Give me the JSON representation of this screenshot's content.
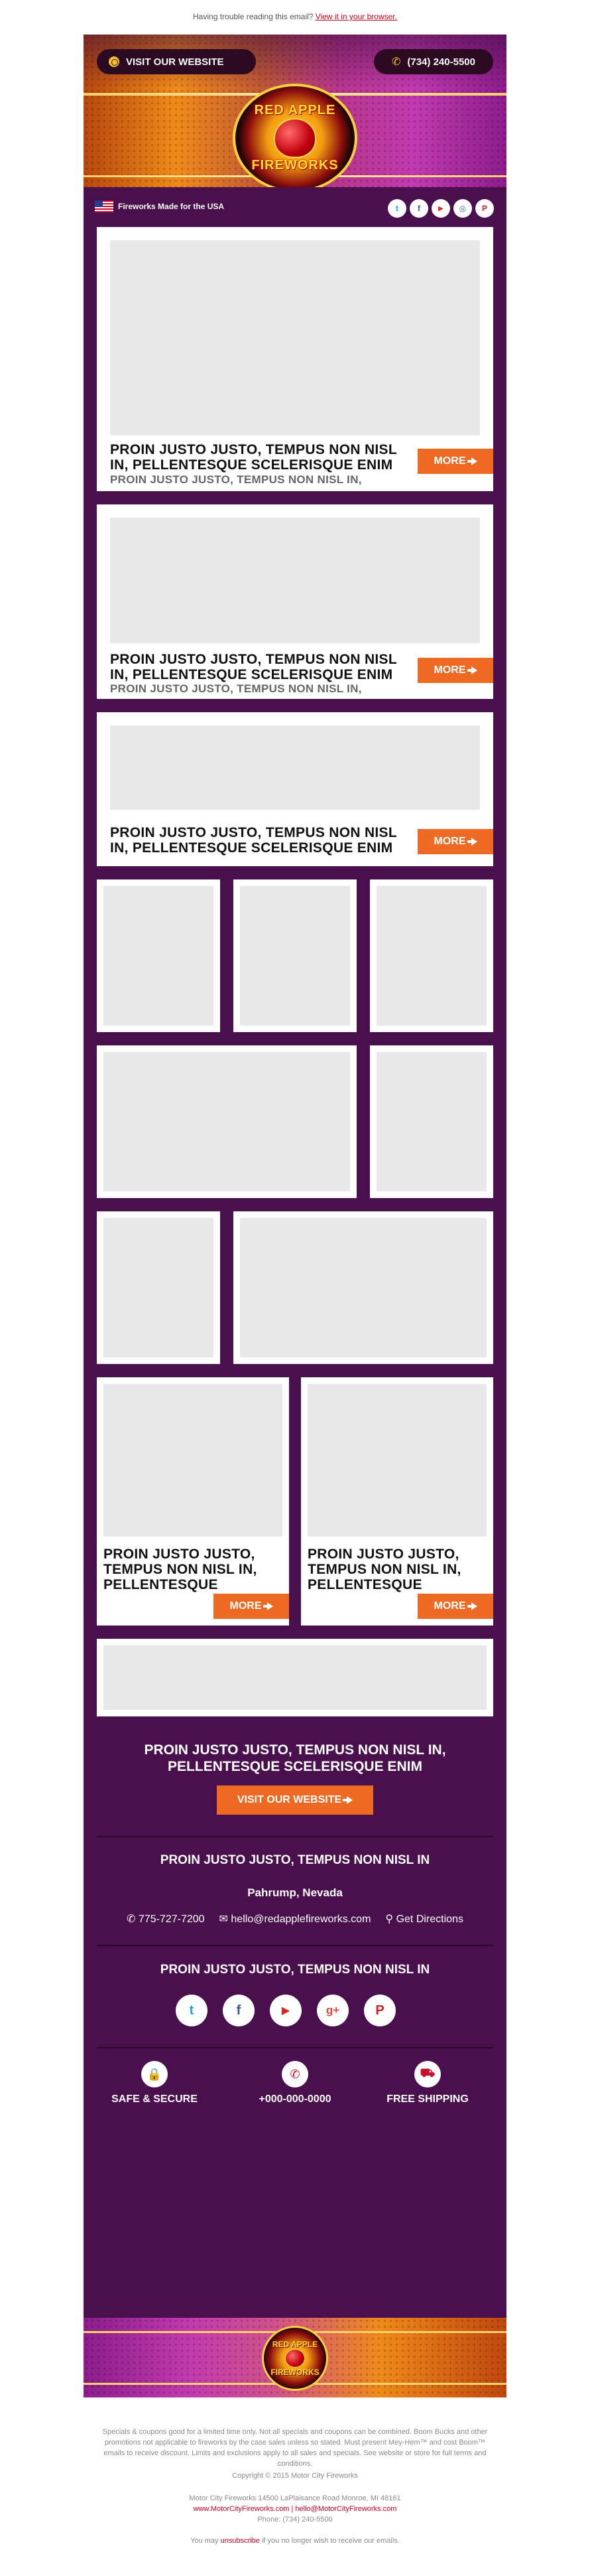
{
  "preheader": {
    "text": "Having trouble reading this email?",
    "link": "View it in your browser."
  },
  "header": {
    "website_label": "VISIT OUR WEBSITE",
    "phone_label": "(734) 240-5500",
    "logo_line1": "RED APPLE",
    "logo_line2": "FIREWORKS"
  },
  "usa_bar": {
    "text": "Fireworks Made for the USA",
    "social": [
      {
        "icon": "twitter-icon",
        "glyph": "t",
        "color": "#1da1f2"
      },
      {
        "icon": "facebook-icon",
        "glyph": "f",
        "color": "#3b5998"
      },
      {
        "icon": "youtube-icon",
        "glyph": "▶",
        "color": "#e62117"
      },
      {
        "icon": "instagram-icon",
        "glyph": "◎",
        "color": "#3f729b"
      },
      {
        "icon": "pinterest-icon",
        "glyph": "P",
        "color": "#cb2027"
      }
    ]
  },
  "features": [
    {
      "title": "PROIN JUSTO JUSTO, TEMPUS NON NISL IN, PELLENTESQUE SCELERISQUE ENIM",
      "subtitle": "PROIN JUSTO JUSTO, TEMPUS NON NISL IN,",
      "more": "MORE"
    },
    {
      "title": "PROIN JUSTO JUSTO, TEMPUS NON NISL IN, PELLENTESQUE SCELERISQUE ENIM",
      "subtitle": "PROIN JUSTO JUSTO, TEMPUS NON NISL IN,",
      "more": "MORE"
    },
    {
      "title": "PROIN JUSTO JUSTO, TEMPUS NON NISL IN, PELLENTESQUE SCELERISQUE ENIM",
      "more": "MORE"
    }
  ],
  "two_col": [
    {
      "title": "PROIN JUSTO JUSTO, TEMPUS NON NISL IN, PELLENTESQUE",
      "more": "MORE"
    },
    {
      "title": "PROIN JUSTO JUSTO, TEMPUS NON NISL IN, PELLENTESQUE",
      "more": "MORE"
    }
  ],
  "promo": {
    "headline": "PROIN JUSTO JUSTO, TEMPUS NON NISL IN, PELLENTESQUE SCELERISQUE ENIM",
    "cta": "VISIT OUR WEBSITE"
  },
  "location": {
    "heading": "PROIN JUSTO JUSTO, TEMPUS NON NISL IN",
    "city": "Pahrump, Nevada",
    "phone": "775-727-7200",
    "email": "hello@redapplefireworks.com",
    "directions": "Get Directions"
  },
  "social_section": {
    "heading": "PROIN JUSTO JUSTO, TEMPUS NON NISL IN",
    "icons": [
      {
        "icon": "twitter-icon",
        "glyph": "t",
        "color": "#1da1f2"
      },
      {
        "icon": "facebook-icon",
        "glyph": "f",
        "color": "#3b5998"
      },
      {
        "icon": "youtube-icon",
        "glyph": "▶",
        "color": "#e62117"
      },
      {
        "icon": "google-plus-icon",
        "glyph": "g+",
        "color": "#dd4b39"
      },
      {
        "icon": "pinterest-icon",
        "glyph": "P",
        "color": "#cb2027"
      }
    ]
  },
  "badges": [
    {
      "icon": "lock-icon",
      "glyph": "🔒",
      "label": "SAFE & SECURE"
    },
    {
      "icon": "phone-icon",
      "glyph": "✆",
      "label": "+000-000-0000"
    },
    {
      "icon": "truck-icon",
      "glyph": "⛟",
      "label": "FREE SHIPPING"
    }
  ],
  "footer_logo": {
    "line1": "RED APPLE",
    "line2": "FIREWORKS"
  },
  "legal": {
    "disclaimer": "Specials & coupons good for a limited time only. Not all specials and coupons can be combined. Boom Bucks and other promotions not applicable to fireworks by the case sales unless so stated. Must present Mey-Hem™ and cost Boom™ emails to receive discount. Limits and exclusions apply to all sales and specials. See website or store for full terms and conditions.",
    "copyright": "Copyright © 2015 Motor City Fireworks",
    "address": "Motor City Fireworks 14500 LaPlaisance Road Monroe, MI 48161",
    "links": "www.MotorCityFireworks.com | hello@MotorCityFireworks.com",
    "phone": "Phone: (734) 240-5500",
    "unsub_pre": "You may",
    "unsub_link": "unsubscribe",
    "unsub_post": "if you no longer wish to receive our emails."
  }
}
